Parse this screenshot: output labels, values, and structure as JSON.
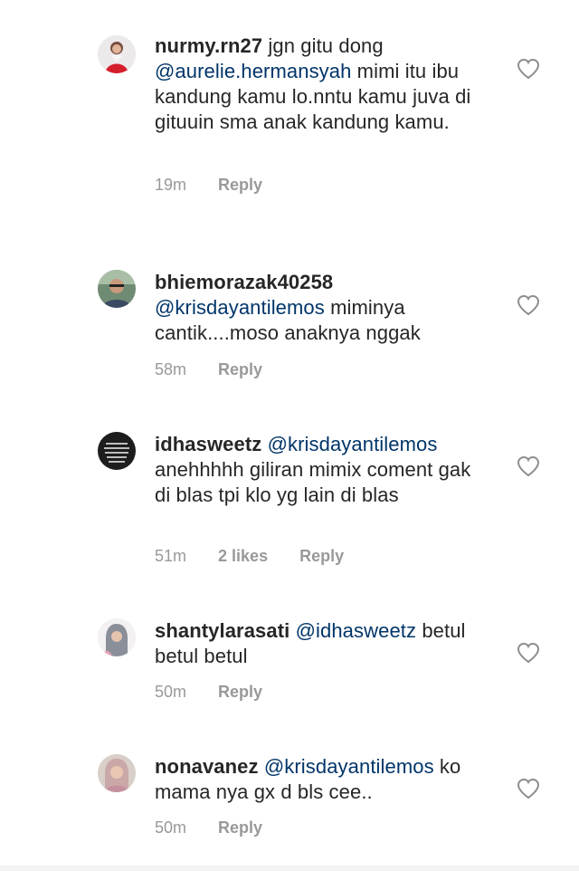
{
  "comments": [
    {
      "username": "nurmy.rn27",
      "pre": "jgn gitu dong",
      "mention": "@aurelie.hermansyah",
      "post": "mimi itu ibu kandung kamu lo.nntu kamu juva di gituuin sma anak kandung kamu.",
      "time": "19m",
      "likes": "",
      "reply": "Reply",
      "avatar_icon": "avatar-red-outfit"
    },
    {
      "username": "bhiemorazak40258",
      "pre": "",
      "mention": "@krisdayantilemos",
      "post": "miminya cantik....moso anaknya nggak",
      "time": "58m",
      "likes": "",
      "reply": "Reply",
      "avatar_icon": "avatar-man-glasses"
    },
    {
      "username": "idhasweetz",
      "pre": "",
      "mention": "@krisdayantilemos",
      "post": "anehhhhh giliran mimix coment gak di blas tpi klo yg lain di blas",
      "time": "51m",
      "likes": "2 likes",
      "reply": "Reply",
      "avatar_icon": "avatar-dark-text"
    },
    {
      "username": "shantylarasati",
      "pre": "",
      "mention": "@idhasweetz",
      "post": "betul betul betul",
      "time": "50m",
      "likes": "",
      "reply": "Reply",
      "avatar_icon": "avatar-woman-hijab"
    },
    {
      "username": "nonavanez",
      "pre": "",
      "mention": "@krisdayantilemos",
      "post": "ko mama nya gx d bls cee..",
      "time": "50m",
      "likes": "",
      "reply": "Reply",
      "avatar_icon": "avatar-woman-pink"
    }
  ],
  "icons": {
    "like": "heart-outline-icon"
  },
  "colors": {
    "text": "#262626",
    "mention": "#003569",
    "meta": "#999999",
    "background": "#ffffff"
  }
}
